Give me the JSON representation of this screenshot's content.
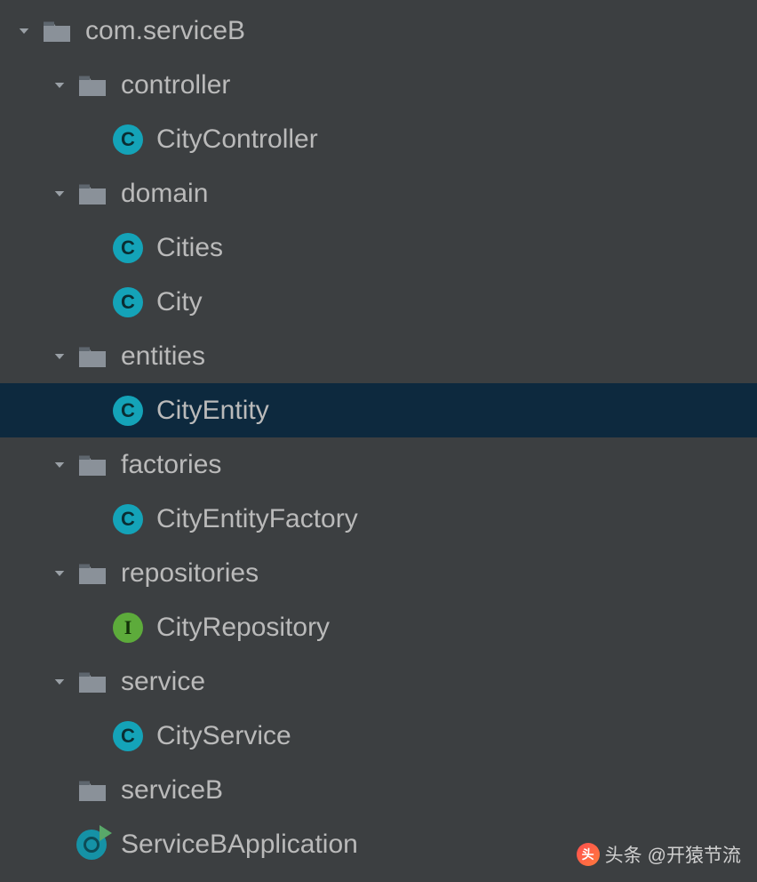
{
  "tree": {
    "root": {
      "label": "com.serviceB",
      "children": {
        "controller": {
          "label": "controller",
          "items": [
            "CityController"
          ]
        },
        "domain": {
          "label": "domain",
          "items": [
            "Cities",
            "City"
          ]
        },
        "entities": {
          "label": "entities",
          "items": [
            "CityEntity"
          ],
          "selected": "CityEntity"
        },
        "factories": {
          "label": "factories",
          "items": [
            "CityEntityFactory"
          ]
        },
        "repositories": {
          "label": "repositories",
          "items": [
            "CityRepository"
          ],
          "interface_items": [
            "CityRepository"
          ]
        },
        "service": {
          "label": "service",
          "items": [
            "CityService"
          ]
        },
        "serviceB_folder": {
          "label": "serviceB"
        },
        "app": {
          "label": "ServiceBApplication"
        }
      }
    }
  },
  "icons": {
    "class_letter": "C",
    "interface_letter": "I"
  },
  "watermark": {
    "prefix": "头条",
    "handle": "@开猿节流"
  }
}
